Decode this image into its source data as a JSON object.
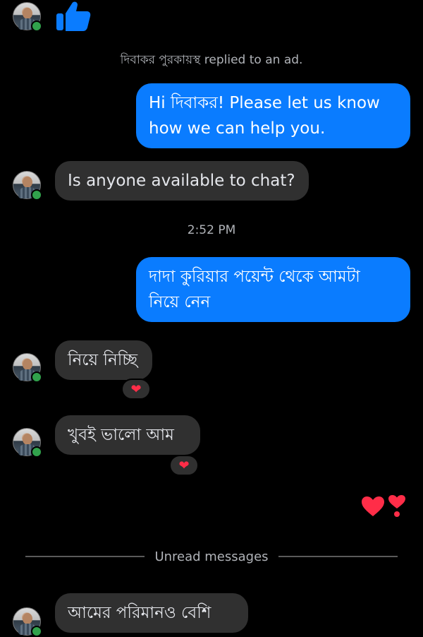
{
  "system": {
    "ad_reply_note": "দিবাকর পুরকায়স্থ replied to an ad."
  },
  "messages": {
    "m1_out": "Hi দিবাকর! Please let us know\nhow we can help you.",
    "m2_in": "Is anyone available to chat?",
    "time1": "2:52 PM",
    "m3_out": "দাদা কুরিয়ার পয়েন্ট থেকে আমটা\nনিয়ে নেন",
    "m4_in": "নিয়ে নিচ্ছি",
    "m5_in": "খুবই ভালো আম",
    "m6_in": "আমের পরিমানও বেশি"
  },
  "reactions": {
    "m4": "❤",
    "m5": "❤",
    "sticker": "❤❣"
  },
  "divider": {
    "label": "Unread messages"
  },
  "icons": {
    "like": "thumbs-up-icon",
    "online": "online-status-icon",
    "heart": "heart-icon"
  },
  "colors": {
    "background": "#000000",
    "outgoing_bubble": "#0a7cff",
    "incoming_bubble": "#303030",
    "online": "#31a24c",
    "heart": "#ff2d48",
    "like": "#0a7cff"
  }
}
